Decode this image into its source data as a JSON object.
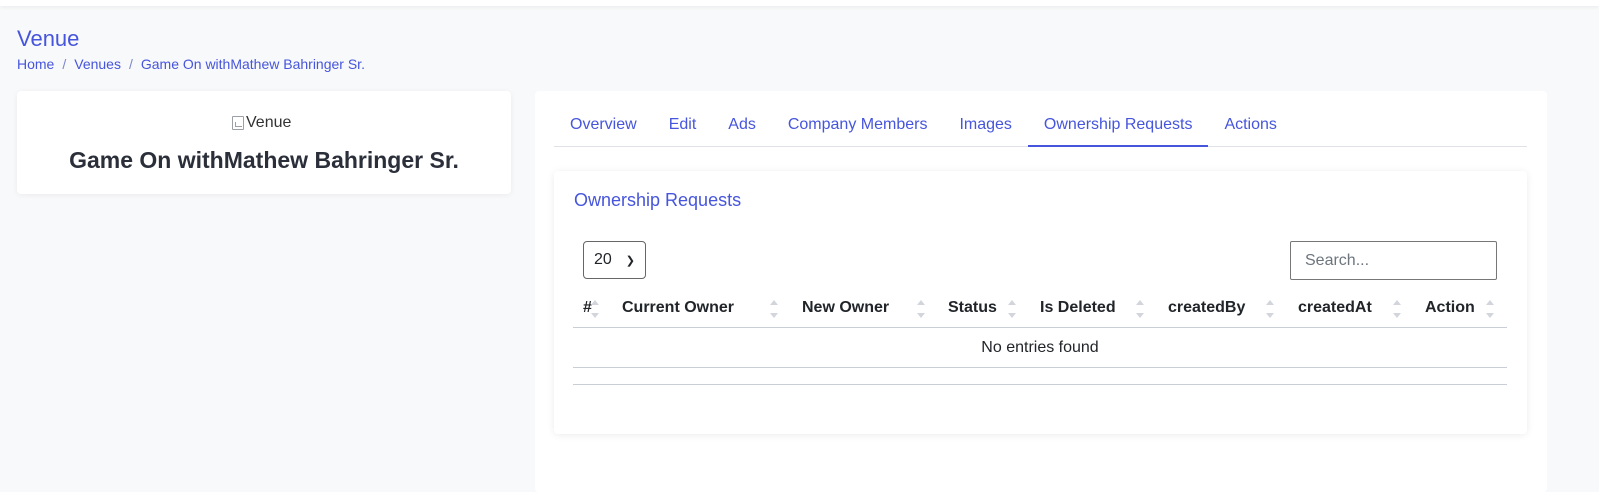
{
  "page": {
    "title": "Venue",
    "breadcrumb": [
      "Home",
      "Venues",
      "Game On withMathew Bahringer Sr."
    ],
    "breadcrumb_separator": "/"
  },
  "venue_card": {
    "image_alt": "Venue",
    "name": "Game On withMathew Bahringer Sr."
  },
  "tabs": [
    {
      "label": "Overview",
      "active": false
    },
    {
      "label": "Edit",
      "active": false
    },
    {
      "label": "Ads",
      "active": false
    },
    {
      "label": "Company Members",
      "active": false
    },
    {
      "label": "Images",
      "active": false
    },
    {
      "label": "Ownership Requests",
      "active": true
    },
    {
      "label": "Actions",
      "active": false
    }
  ],
  "ownership_requests": {
    "title": "Ownership Requests",
    "page_size": "20",
    "search_placeholder": "Search...",
    "columns": [
      "#",
      "Current Owner",
      "New Owner",
      "Status",
      "Is Deleted",
      "createdBy",
      "createdAt",
      "Action"
    ],
    "empty_message": "No entries found"
  },
  "colors": {
    "accent": "#4655dc",
    "background": "#f8f9fa"
  },
  "icons": {
    "page_size_dropdown": "chevron-down-icon",
    "sort": "sort-icon"
  }
}
